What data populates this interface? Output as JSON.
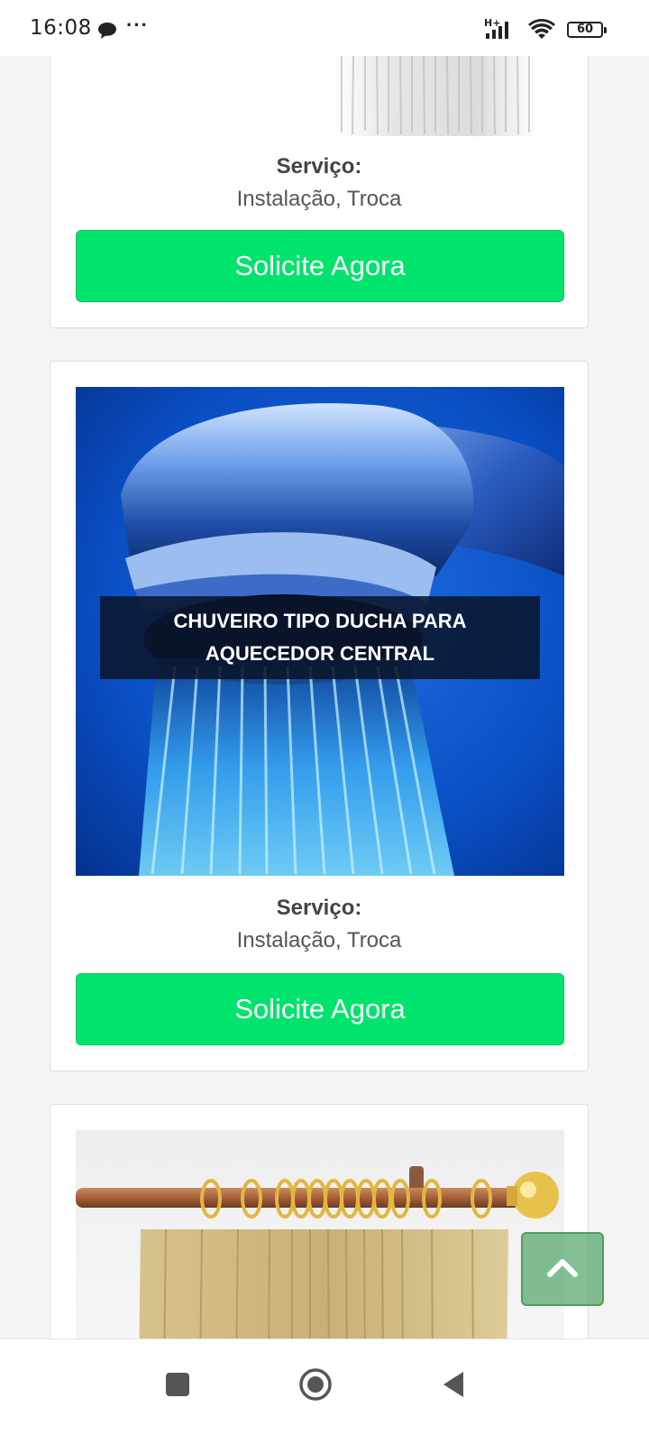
{
  "status_bar": {
    "time": "16:08",
    "network": "H+",
    "battery": "60",
    "icons": [
      "chat-bubble-icon",
      "more-dots-icon",
      "signal-icon",
      "wifi-icon",
      "battery-icon"
    ]
  },
  "cards": [
    {
      "service_label": "Serviço:",
      "service_value": "Instalação, Troca",
      "cta_label": "Solicite Agora"
    },
    {
      "image_caption_line1": "CHUVEIRO TIPO DUCHA PARA",
      "image_caption_line2": "AQUECEDOR CENTRAL",
      "service_label": "Serviço:",
      "service_value": "Instalação, Troca",
      "cta_label": "Solicite Agora"
    },
    {
      "image_subject": "curtain-rod-photo"
    }
  ],
  "scroll_top": {
    "icon": "chevron-up-icon"
  },
  "nav_bar": {
    "icons": [
      "recent-apps-icon",
      "home-icon",
      "back-icon"
    ]
  },
  "colors": {
    "cta_green": "#00e36c",
    "background": "#f4f4f4",
    "scroll_top_green": "#5aaa6e"
  }
}
